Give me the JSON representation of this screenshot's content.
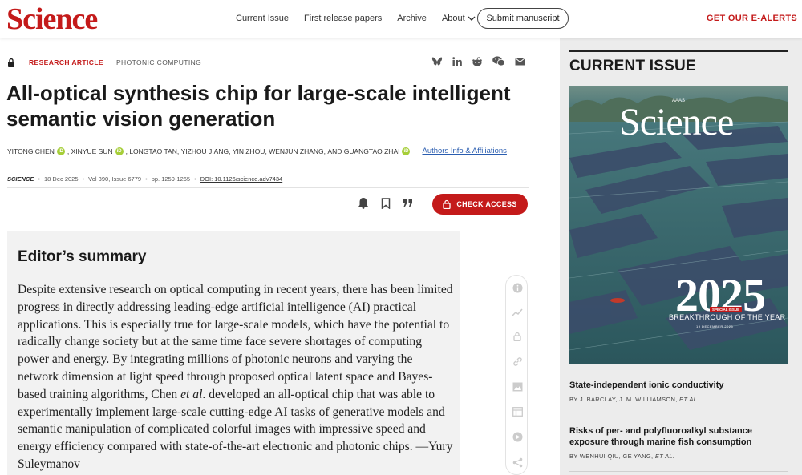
{
  "header": {
    "logo": "Science",
    "nav": [
      "Current Issue",
      "First release papers",
      "Archive"
    ],
    "about": "About",
    "submit": "Submit manuscript",
    "alerts": "GET OUR E-ALERTS"
  },
  "article": {
    "type": "RESEARCH ARTICLE",
    "subject": "PHOTONIC COMPUTING",
    "title": "All-optical synthesis chip for large-scale intelligent se­mantic vision generation",
    "authors": [
      "YITONG CHEN",
      "XINYUE SUN",
      "LONGTAO TAN",
      "YIZHOU JIANG",
      "YIN ZHOU",
      "WENJUN ZHANG",
      "GUANGTAO ZHAI"
    ],
    "and": "AND",
    "affiliations": "Authors Info & Affiliations",
    "journal": "SCIENCE",
    "date": "18 Dec 2025",
    "volume": "Vol 390, Issue 6779",
    "pages": "pp. 1259-1265",
    "doi": "DOI: 10.1126/science.adv7434",
    "check_access": "CHECK ACCESS"
  },
  "summary": {
    "heading": "Editor’s summary",
    "text_before": "Despite extensive research on optical computing in recent years, there has been limited progress in directly addressing leading-edge artificial intelligence (AI) practical applications. This is especially true for large-scale models, which have the potential to radically change society but at the same time face severe shortages of computing power and energy. By integrating millions of photonic neurons and varying the network dimension at light speed through proposed optical latent space and Bayes-based training algorithms, Chen ",
    "etal": "et al",
    "text_after": ". developed an all-optical chip that was able to experimentally implement large-scale cutting-edge AI tasks of generative models and semantic manipulation of complicated colorful images with impressive speed and energy efficiency compared with state-of-the-art elec­tronic and photonic chips. —Yury Suleymanov"
  },
  "sidebar": {
    "title": "CURRENT ISSUE",
    "cover": {
      "science": "Science",
      "aaas": "AAAS",
      "year": "2025",
      "tag": "SPECIAL ISSUE",
      "bty": "BREAKTHROUGH OF THE YEAR",
      "date": "19 DECEMBER 2025"
    },
    "items": [
      {
        "title": "State-independent ionic conductivity",
        "authors": "BY J. BARCLAY, J. M. WILLIAMSON,",
        "etal": "ET AL."
      },
      {
        "title": "Risks of per- and polyfluoroalkyl substance exposure through marine fish consumption",
        "authors": "BY WENHUI QIU, GE YANG,",
        "etal": "ET AL."
      }
    ]
  },
  "colors": {
    "brand": "#c41a1a",
    "link": "#2a5db0",
    "orcid": "#a6ce39"
  },
  "icons": [
    "lock-icon",
    "bluesky-icon",
    "linkedin-icon",
    "reddit-icon",
    "wechat-icon",
    "email-icon",
    "bell-icon",
    "bookmark-icon",
    "quote-icon",
    "info-icon",
    "metrics-icon",
    "access-icon",
    "link-icon",
    "figures-icon",
    "tables-icon",
    "media-icon",
    "share-icon"
  ]
}
